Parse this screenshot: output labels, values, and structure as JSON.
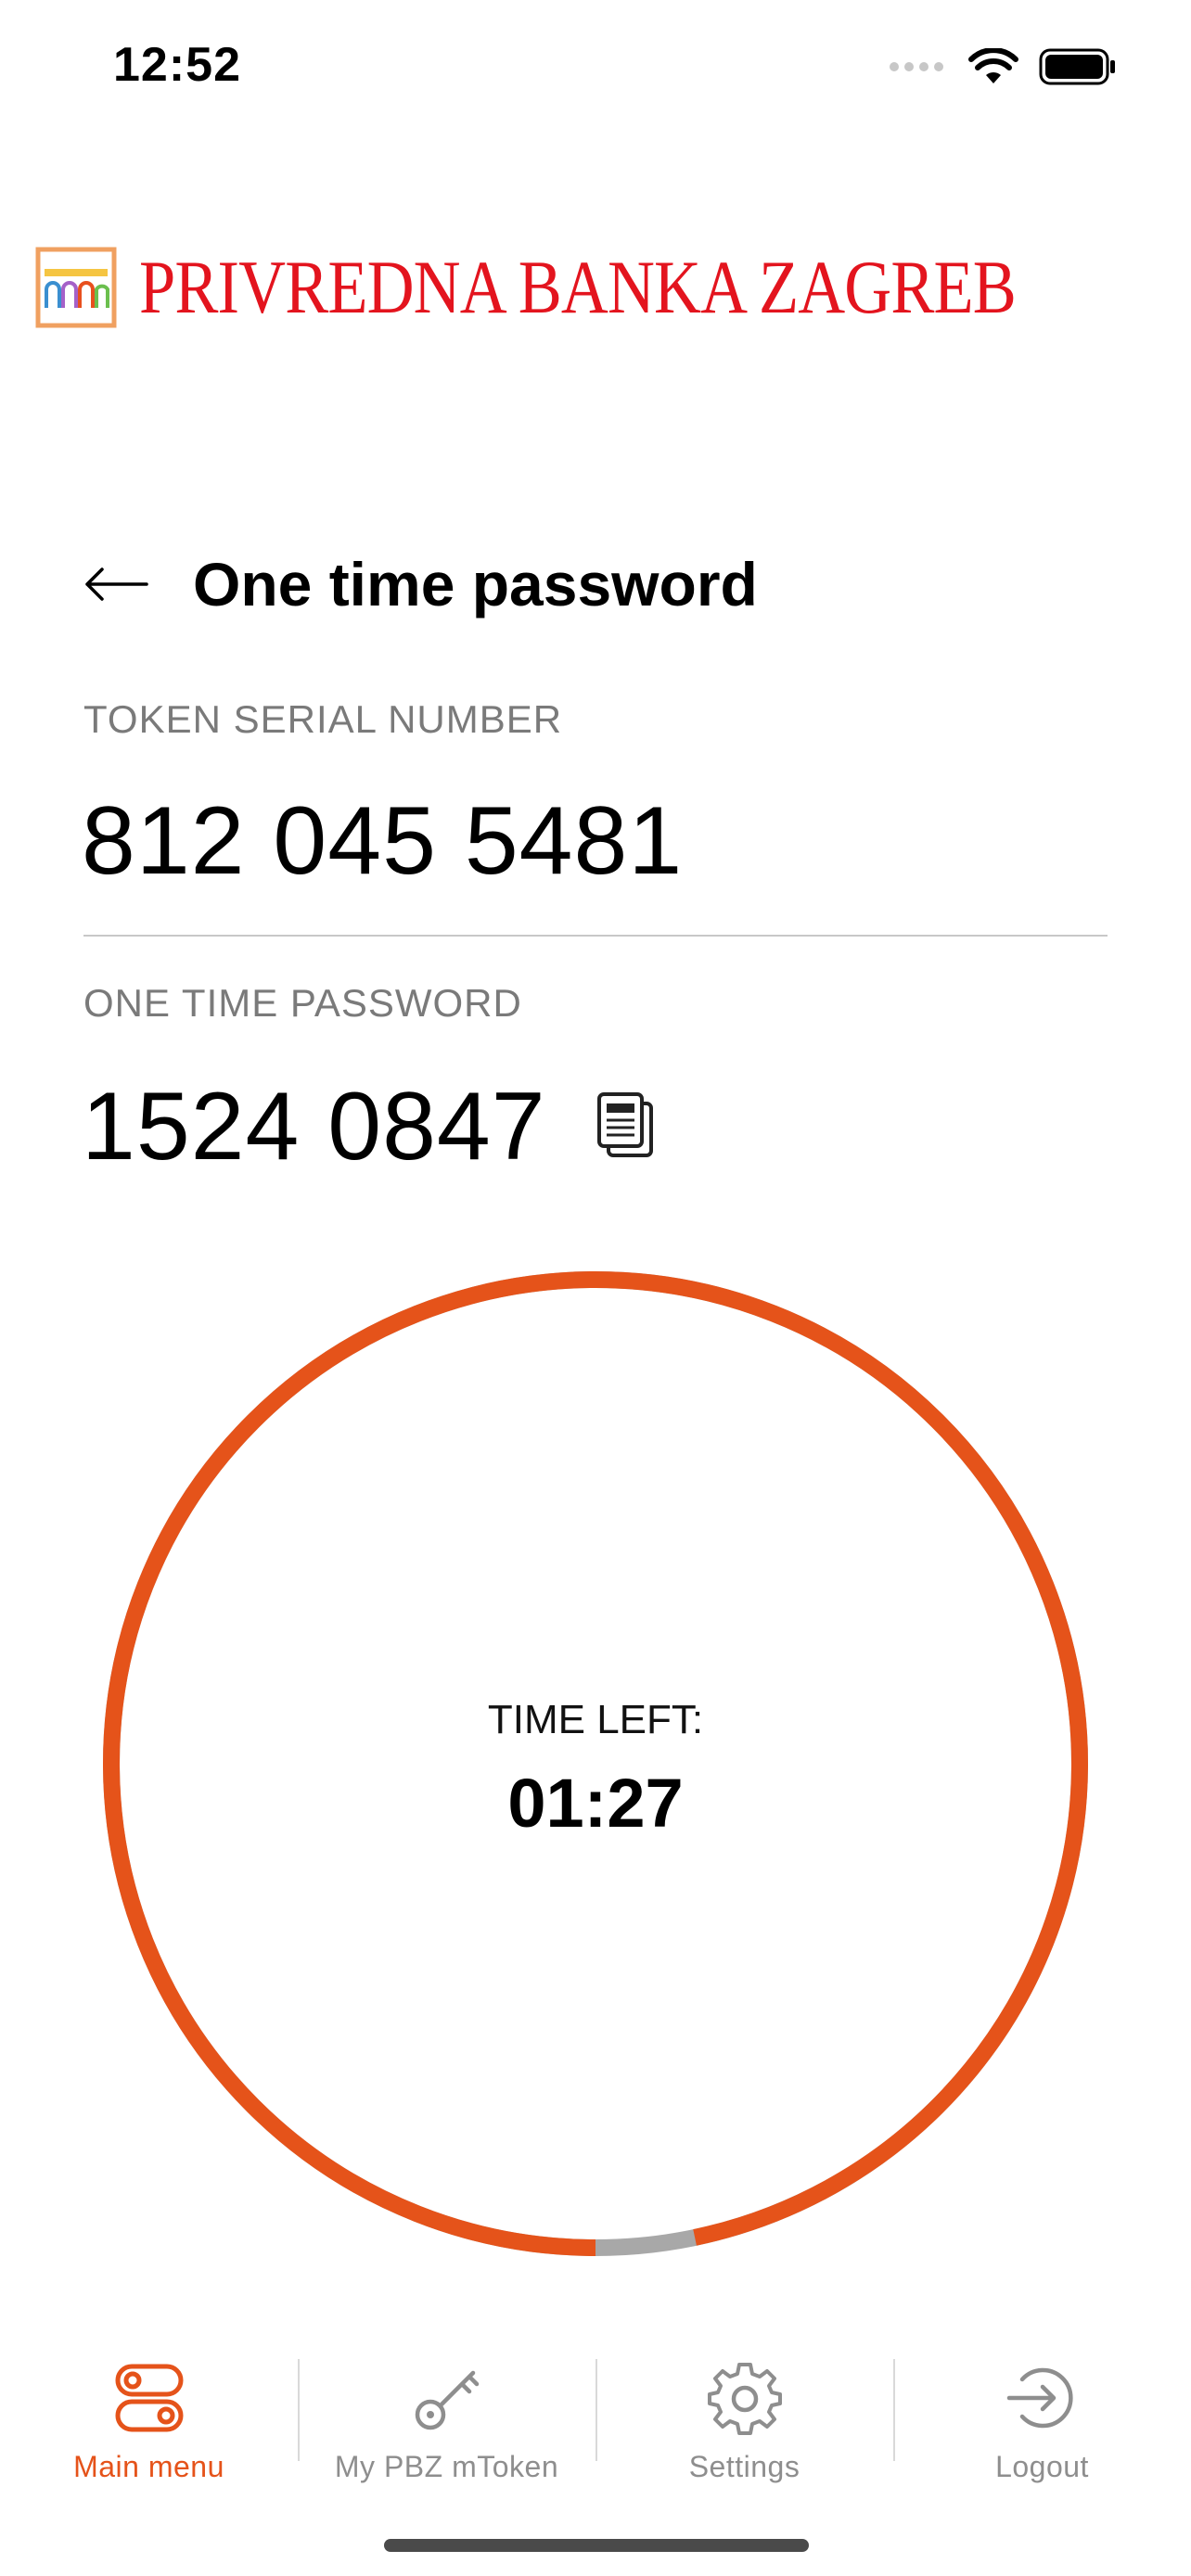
{
  "status_bar": {
    "time": "12:52",
    "icons": [
      "signal-dots-icon",
      "wifi-icon",
      "battery-icon"
    ]
  },
  "logo": {
    "text": "PRIVREDNA BANKA ZAGREB",
    "icon": "pbz-logo-icon",
    "color": "#e3141e"
  },
  "header": {
    "title": "One time password",
    "back_icon": "arrow-left-icon"
  },
  "token": {
    "label": "TOKEN SERIAL NUMBER",
    "value": "812 045 5481"
  },
  "otp": {
    "label": "ONE TIME PASSWORD",
    "value": "1524 0847",
    "copy_icon": "copy-icon"
  },
  "timer": {
    "label": "TIME LEFT:",
    "value": "01:27",
    "remaining_fraction": 0.967,
    "ring_color": "#e5531a",
    "track_color": "#a8a8a8"
  },
  "tabs": [
    {
      "label": "Main menu",
      "icon": "toggles-icon",
      "active": true
    },
    {
      "label": "My PBZ mToken",
      "icon": "key-icon",
      "active": false
    },
    {
      "label": "Settings",
      "icon": "gear-icon",
      "active": false
    },
    {
      "label": "Logout",
      "icon": "logout-icon",
      "active": false
    }
  ],
  "colors": {
    "accent": "#e5531a",
    "inactive": "#8e8e8e"
  }
}
